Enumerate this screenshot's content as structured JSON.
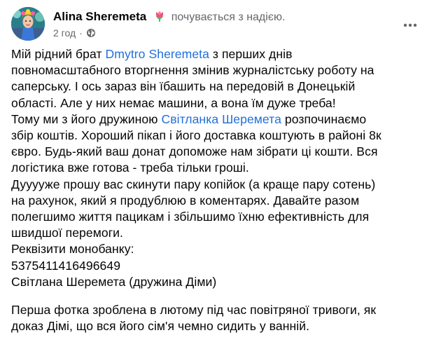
{
  "post": {
    "author_name": "Alina Sheremeta",
    "feeling_icon": "tulip-emoji-icon",
    "feeling_text": "почувається з надією.",
    "timestamp": "2 год",
    "separator": "·",
    "privacy_icon": "globe-icon",
    "more_icon": "more-options-icon",
    "body": {
      "line1_before": "Мій рідний брат ",
      "mention1": "Dmytro  Sheremeta",
      "line1_after": " з перших днів",
      "line2": "повномасштабного вторгнення змінив журналістську роботу на",
      "line3": "саперську. І ось зараз він їбашить на передовій в Донецькій",
      "line4": "області. Але у них немає машини, а вона їм дуже треба!",
      "line5_before": "Тому ми з його дружиною ",
      "mention2": "Світланка Шеремета",
      "line5_after": " розпочинаємо",
      "line6": "збір коштів. Хороший пікап і його доставка коштують в районі 8к",
      "line7": "євро. Будь-який ваш донат допоможе нам зібрати ці кошти. Вся",
      "line8": "логістика вже готова - треба тільки гроші.",
      "line9": "Дууууже прошу вас скинути пару копійок (а краще пару сотень)",
      "line10": "на рахунок, який я продублюю в коментарях. Давайте разом",
      "line11": "полегшимо життя пацикам і збільшимо їхню ефективність для",
      "line12": "швидшої перемоги.",
      "line13": "Реквізити монобанку:",
      "line14": "5375411416496649",
      "line15": "Світлана Шеремета (дружина Діми)",
      "p2_line1": "Перша фотка зроблена в лютому під час повітряної тривоги, як",
      "p2_line2": "доказ Дімі, що вся його сім'я чемно сидить у ванній."
    }
  },
  "colors": {
    "text": "#050505",
    "secondary_text": "#65676b",
    "mention": "#216fdb",
    "background": "#ffffff"
  }
}
